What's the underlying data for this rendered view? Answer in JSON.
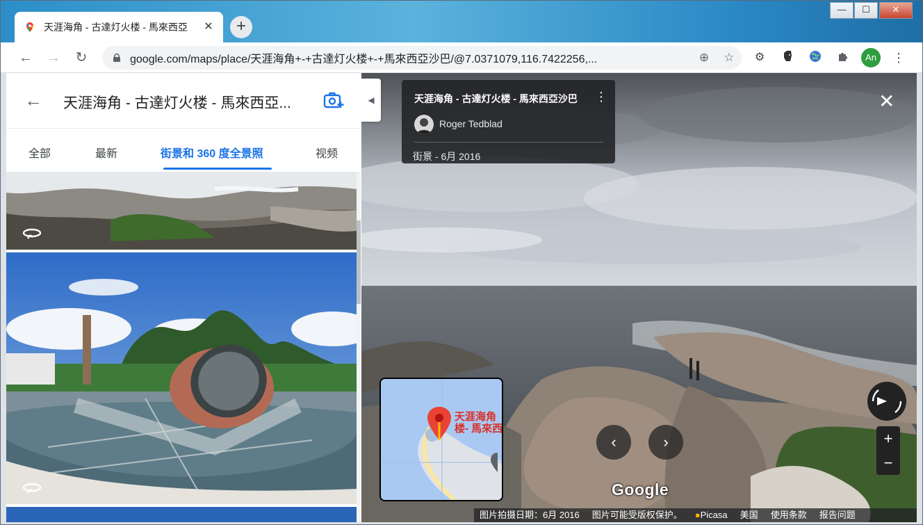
{
  "browser": {
    "tab_title": "天涯海角 - 古達灯火楼 - 馬來西亞",
    "tab_close": "✕",
    "new_tab": "+",
    "window_controls": {
      "minimize": "—",
      "maximize": "☐",
      "close": "✕"
    },
    "url": "google.com/maps/place/天涯海角+-+古達灯火楼+-+馬來西亞沙巴/@7.0371079,116.7422256,...",
    "avatar_label": "An"
  },
  "left_panel": {
    "title": "天涯海角 - 古達灯火楼 - 馬來西亞...",
    "tabs": [
      {
        "label": "全部"
      },
      {
        "label": "最新"
      },
      {
        "label": "街景和 360 度全景照"
      },
      {
        "label": "视频"
      }
    ],
    "active_tab": "街景和 360 度全景照"
  },
  "viewer": {
    "place_title": "天涯海角 - 古達灯火楼 - 馬來西亞沙巴",
    "author": "Roger Tedblad",
    "date_text": "街景 - 6月 2016",
    "minimap_label_line1": "天涯海角",
    "minimap_label_line2": "楼- 馬來西",
    "google_logo": "Google",
    "footer": {
      "capture_date": "图片拍摄日期：6月 2016",
      "copyright": "图片可能受版权保护。",
      "source": "Picasa",
      "country": "美国",
      "terms": "使用条款",
      "report": "报告问题"
    }
  },
  "colors": {
    "accent": "#1a73e8",
    "pin": "#ea4335",
    "avatar_bg": "#2e9e3e"
  }
}
